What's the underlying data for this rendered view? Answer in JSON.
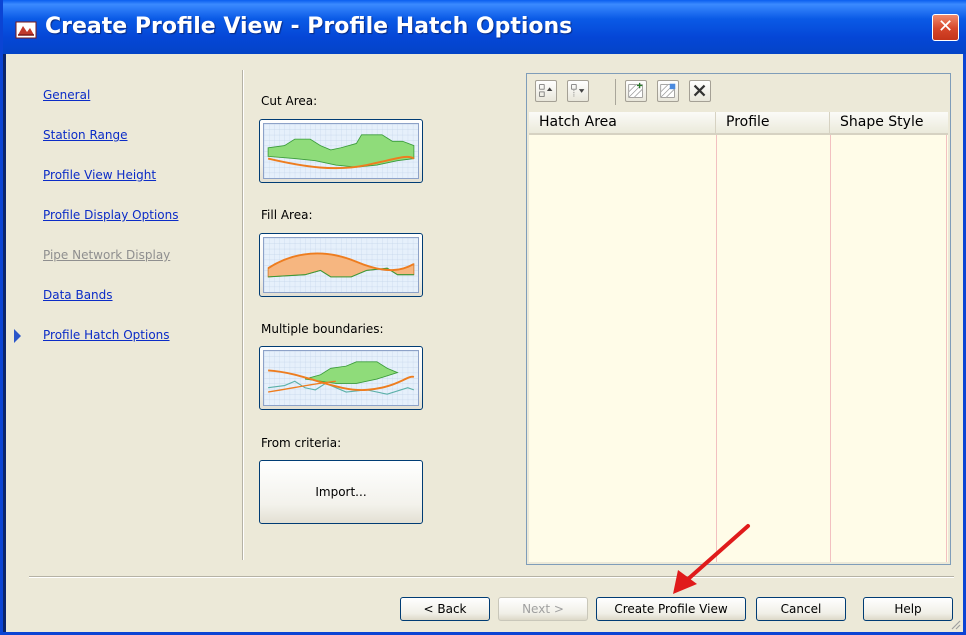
{
  "window": {
    "title": "Create Profile View - Profile Hatch Options",
    "close_label": "✕"
  },
  "nav": {
    "items": [
      {
        "label": "General",
        "enabled": true
      },
      {
        "label": "Station Range",
        "enabled": true
      },
      {
        "label": "Profile View Height",
        "enabled": true
      },
      {
        "label": "Profile Display Options",
        "enabled": true
      },
      {
        "label": "Pipe Network Display",
        "enabled": false
      },
      {
        "label": "Data Bands",
        "enabled": true
      },
      {
        "label": "Profile Hatch Options",
        "enabled": true,
        "current": true
      }
    ]
  },
  "hatch_options": {
    "cut_area_label": "Cut Area:",
    "fill_area_label": "Fill Area:",
    "multiple_label": "Multiple boundaries:",
    "criteria_label": "From criteria:",
    "import_label": "Import..."
  },
  "grid": {
    "toolbar_icons": [
      "move-up-icon",
      "move-down-icon",
      "hatch-add-icon",
      "hatch-edit-icon",
      "delete-icon"
    ],
    "columns": [
      "Hatch Area",
      "Profile",
      "Shape Style"
    ],
    "rows": []
  },
  "buttons": {
    "back": "< Back",
    "next": "Next >",
    "create": "Create Profile View",
    "cancel": "Cancel",
    "help": "Help"
  },
  "colors": {
    "link": "#0b2cc7",
    "cut_fill": "#8fdc7a",
    "fill_fill": "#f6b680",
    "arrow": "#e01b1b"
  }
}
